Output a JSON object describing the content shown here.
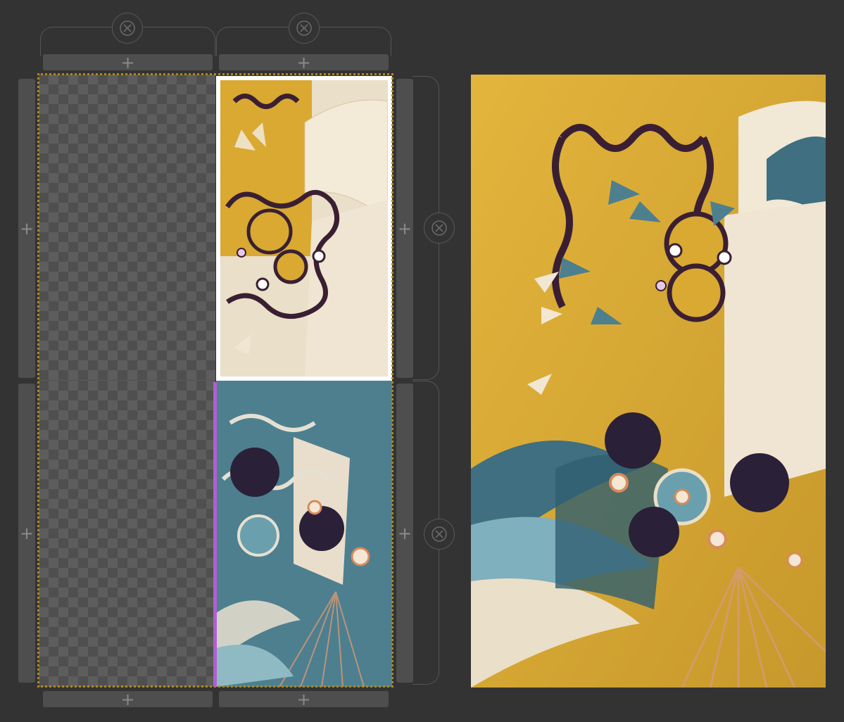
{
  "add_symbol": "+",
  "colors": {
    "background": "#333333",
    "add_bar": "#4e4e4e",
    "grid_outline": "#b08a1a",
    "selected_border": "#ffffff",
    "split_indicator": "#b05fd0",
    "art_yellow": "#d9a931",
    "art_teal": "#4d7f8f",
    "art_cream": "#eadfc8",
    "art_plum": "#3a1f33"
  },
  "icons": {
    "add": "plus-icon",
    "remove": "close-circle-icon"
  },
  "grid": {
    "columns": 2,
    "rows": 2,
    "cells": [
      {
        "row": 1,
        "col": 1,
        "content": "empty"
      },
      {
        "row": 1,
        "col": 2,
        "content": "image",
        "tone": "yellow",
        "selected": true
      },
      {
        "row": 2,
        "col": 1,
        "content": "empty"
      },
      {
        "row": 2,
        "col": 2,
        "content": "image",
        "tone": "teal",
        "selected": false
      }
    ]
  }
}
